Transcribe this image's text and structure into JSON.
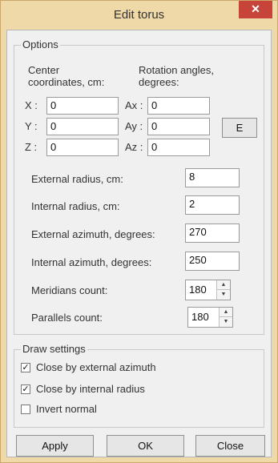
{
  "window": {
    "title": "Edit torus",
    "close_glyph": "✕"
  },
  "options": {
    "group_title": "Options",
    "center_label_line1": "Center",
    "center_label_line2": "coordinates, cm:",
    "rotation_label_line1": "Rotation angles,",
    "rotation_label_line2": "degrees:",
    "x_label": "X :",
    "x_value": "0",
    "y_label": "Y :",
    "y_value": "0",
    "z_label": "Z :",
    "z_value": "0",
    "ax_label": "Ax :",
    "ax_value": "0",
    "ay_label": "Ay :",
    "ay_value": "0",
    "az_label": "Az :",
    "az_value": "0",
    "e_button": "E",
    "external_radius_label": "External radius, cm:",
    "external_radius_value": "8",
    "internal_radius_label": "Internal radius, cm:",
    "internal_radius_value": "2",
    "external_azimuth_label": "External azimuth, degrees:",
    "external_azimuth_value": "270",
    "internal_azimuth_label": "Internal azimuth, degrees:",
    "internal_azimuth_value": "250",
    "meridians_label": "Meridians count:",
    "meridians_value": "180",
    "parallels_label": "Parallels count:",
    "parallels_value": "180"
  },
  "draw_settings": {
    "group_title": "Draw settings",
    "close_external_azimuth": {
      "label": "Close by external azimuth",
      "checked": true
    },
    "close_internal_radius": {
      "label": "Close by internal radius",
      "checked": true
    },
    "invert_normal": {
      "label": "Invert normal",
      "checked": false
    }
  },
  "buttons": {
    "apply": "Apply",
    "ok": "OK",
    "close": "Close"
  },
  "colors": {
    "frame": "#f0d9a8",
    "close_button": "#c7443a",
    "client": "#f0f0f0"
  }
}
